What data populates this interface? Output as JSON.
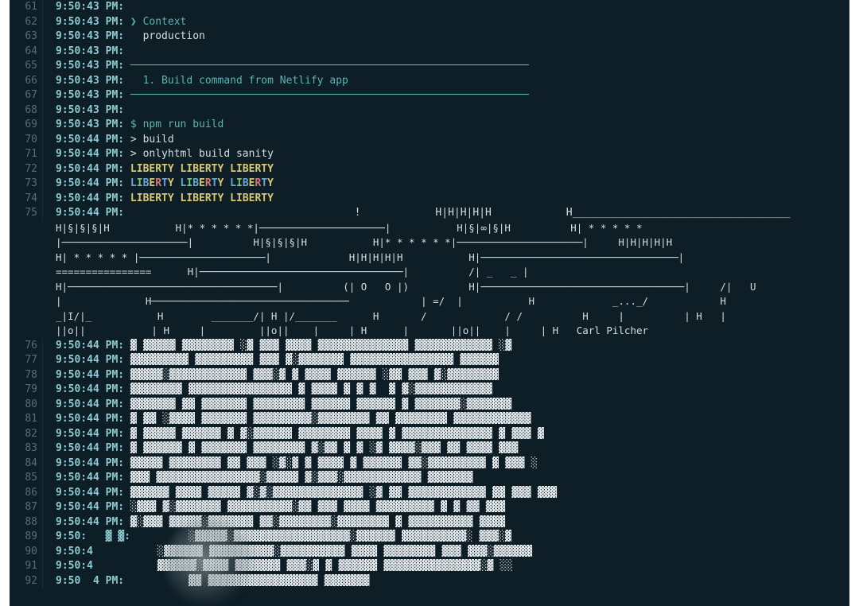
{
  "lines": [
    {
      "n": 61,
      "ts": "9:50:43 PM:",
      "text": ""
    },
    {
      "n": 62,
      "ts": "9:50:43 PM:",
      "prefix": "❯ ",
      "prefixClass": "teal",
      "text": "Context",
      "textClass": "teal"
    },
    {
      "n": 63,
      "ts": "9:50:43 PM:",
      "text": "  production",
      "textClass": "white"
    },
    {
      "n": 64,
      "ts": "9:50:43 PM:",
      "text": ""
    },
    {
      "n": 65,
      "ts": "9:50:43 PM:",
      "text": "────────────────────────────────────────────────────────────────",
      "textClass": "teal-line"
    },
    {
      "n": 66,
      "ts": "9:50:43 PM:",
      "text": "  1. Build command from Netlify app",
      "textClass": "teal"
    },
    {
      "n": 67,
      "ts": "9:50:43 PM:",
      "text": "────────────────────────────────────────────────────────────────",
      "textClass": "teal-line"
    },
    {
      "n": 68,
      "ts": "9:50:43 PM:",
      "text": ""
    },
    {
      "n": 69,
      "ts": "9:50:43 PM:",
      "text": "$ npm run build",
      "textClass": "cmd"
    },
    {
      "n": 70,
      "ts": "9:50:44 PM:",
      "text": "> build",
      "textClass": "white"
    },
    {
      "n": 71,
      "ts": "9:50:44 PM:",
      "text": "> onlyhtml build sanity",
      "textClass": "white"
    },
    {
      "n": 72,
      "ts": "9:50:44 PM:",
      "liberty": "yellow"
    },
    {
      "n": 73,
      "ts": "9:50:44 PM:",
      "liberty": "multi"
    },
    {
      "n": 74,
      "ts": "9:50:44 PM:",
      "liberty": "yellow"
    }
  ],
  "ascii": {
    "n": 75,
    "ts": "9:50:44 PM:",
    "rows": [
      "                                    !            H|H|H|H|H            H___________________________________",
      "H|§|§|§|H           H|* * * * * *|─────────────────────|           H|§|∞|§|H          H| * * * * *",
      "|─────────────────────|          H|§|§|§|H           H|* * * * * *|─────────────────────|     H|H|H|H|H",
      "H| * * * * * |─────────────────────|             H|H|H|H|H           H|─────────────────────────────────|",
      "================      H|──────────────────────────────────|          /| _   _ |",
      "H|───────────────────────────────────|          (| O   O |)          H|──────────────────────────────────|     /|   U",
      "|              H─────────────────────────────────            | =/  |           H             _..._/            H",
      "_|I/|_           H        _______/| H |/_______      H       /             / /          H     |          | H   |",
      "||o||           | H     |         ||o||    |     | H      |       ||o||    |     | H   Carl Pilcher"
    ]
  },
  "garbled": [
    {
      "n": 76,
      "ts": "9:50:44 PM:",
      "text": "▓ ▓▓▓▓▓ ▓▓▓▓▓▓▓▓ ░▓ ▓▓▓ ▓▓▓▓ ▓▓▓▓▓▓▓▓▓▓▓▓▓▓ ▓▓▓▓▓▓▓▓▓▓▓▓ ░▓"
    },
    {
      "n": 77,
      "ts": "9:50:44 PM:",
      "text": "▓▓▓▓▓▓▓▓▓ ▓▓▓▓▓▓▓▓▓ ▓▓▓ ▓░▓▓▓▓▓▓▓ ▓▓▓▓▓▓▓▓▓▓▓▓▓▓▓▓ ▓▓▓▓▓▓"
    },
    {
      "n": 78,
      "ts": "9:50:44 PM:",
      "text": "▓▓▓▓▓░▓▓▓▓▓▓▓▓▓▓▓▓ ▓▓▓░▓ ▓ ▓▓▓▓ ▓▓▓▓▓▓ ░▓▓ ▓▓▓ ▓░▓▓▓▓▓▓▓▓"
    },
    {
      "n": 79,
      "ts": "9:50:44 PM:",
      "text": "▓▓▓▓▓▓▓▓ ▓▓▓▓▓▓▓▓▓▓▓▓▓▓▓▓ ▓ ▓▓▓▓ ▓ ▓ ▓  ▓ ▓░▓▓▓▓▓▓▓▓▓▓▓▓"
    },
    {
      "n": 80,
      "ts": "9:50:44 PM:",
      "text": "▓▓▓▓▓▓▓ ▓▓ ▓▓▓▓▓▓▓ ▓▓▓▓▓▓▓▓ ▓▓▓▓▓▓ ▓▓▓▓▓▓ ▓ ▓▓▓▓▓▓▓░▓▓▓▓▓▓▓"
    },
    {
      "n": 81,
      "ts": "9:50:44 PM:",
      "text": "▓ ▓▓ ░▓▓▓▓ ▓▓▓▓▓▓▓ ▓▓▓▓▓▓▓▓▓░▓▓▓▓▓▓▓▓ ▓▓ ▓▓▓▓▓▓▓▓ ▓▓▓▓▓▓▓▓▓▓▓▓"
    },
    {
      "n": 82,
      "ts": "9:50:44 PM:",
      "text": "▓ ▓▓▓▓▓ ▓▓▓▓▓▓ ▓ ▓░▓▓▓▓▓▓ ▓▓▓▓▓▓▓▓ ▓▓▓▓ ▓ ▓▓▓▓▓▓▓▓▓▓▓▓▓▓ ▓ ▓▓▓ ▓"
    },
    {
      "n": 83,
      "ts": "9:50:44 PM:",
      "text": "▓ ▓▓▓▓▓▓ ▓ ▓▓▓▓▓▓▓ ▓▓▓▓▓▓▓▓ ▓░▓▓ ▓ ▓ ░▓ ▓▓▓▓░▓▓▓ ▓▓ ▓▓▓▓ ▓▓▓"
    },
    {
      "n": 84,
      "ts": "9:50:44 PM:",
      "text": "▓▓▓▓▓ ▓▓▓▓▓▓▓▓ ▓▓ ▓▓▓ ░▓░▓ ▓ ▓▓▓▓ ▓ ▓▓▓▓▓▓ ▓▓░▓▓▓▓▓▓▓▓▓ ▓ ▓▓▓ ░"
    },
    {
      "n": 85,
      "ts": "9:50:44 PM:",
      "text": "▓▓▓ ▓▓▓▓▓▓▓▓▓▓▓▓▓▓▓▓░▓▓▓▓▓ ▓░▓▓▓░▓▓▓▓▓▓▓▓▓▓▓▓ ▓▓▓▓▓▓▓"
    },
    {
      "n": 86,
      "ts": "9:50:44 PM:",
      "text": "▓▓▓▓▓▓ ▓▓▓▓ ▓▓▓▓▓ ▓░▓░▓▓▓▓▓▓▓▓▓▓▓▓▓▓ ░▓ ▓▓ ▓▓▓▓▓▓▓▓▓▓▓▓ ▓▓ ▓▓▓ ▓▓▓"
    },
    {
      "n": 87,
      "ts": "9:50:44 PM:",
      "text": "░▓▓▓ ▓░▓▓▓▓▓▓▓ ▓▓▓▓▓▓▓▓▓▓░▓▓ ▓▓▓ ▓▓▓▓ ▓▓▓▓▓▓▓▓▓ ▓ ▓ ▓▓ ▓▓▓"
    },
    {
      "n": 88,
      "ts": "9:50:44 PM:",
      "text": "▓░▓▓▓ ▓▓▓▓▓░▓▓▓▓▓▓▓ ▓▓░▓▓▓▓▓▓▓▓░▓▓▓▓▓▓▓▓ ▓ ▓▓▓▓▓▓▓▓▓▓ ▓▓▓▓"
    },
    {
      "n": 89,
      "ts": "9:50:   ▓ ▓:",
      "text": "        ░▓▓▓▓▓░▓▓▓▓▓▓▓▓▓▓▓▓▓▓▓▓▓▓░▓▓▓▓▓▓ ▓▓▓▓▓▓▓▓▓▓░ ▓▓▓░▓"
    },
    {
      "n": 90,
      "ts": "9:50:4",
      "text": "         ░▓▓▓▓▓▓ ▓▓▓▓▓▓▓▓▓▓░▓▓▓▓▓▓▓▓▓▓ ▓▓▓▓ ▓▓▓▓▓▓▓▓ ▓▓▓ ▓▓▓░▓▓▓▓▓▓"
    },
    {
      "n": 91,
      "ts": "9:50:4",
      "text": "         ▓▓▓▓▓▓░▓▓▓▓ ▓▓▓▓▓▓▓ ▓▓▓░▓ ▓ ▓▓▓▓▓▓ ▓▓▓▓▓▓▓▓▓▓▓▓▓▓▓░▓ ░░"
    },
    {
      "n": 92,
      "ts": "9:50  4 PM:",
      "text": "         ▓▓ ▓▓▓▓▓▓▓▓▓▓▓▓▓▓▓▓▓ ▓▓▓▓▓▓▓"
    }
  ],
  "libertyWord": "LIBERTY"
}
